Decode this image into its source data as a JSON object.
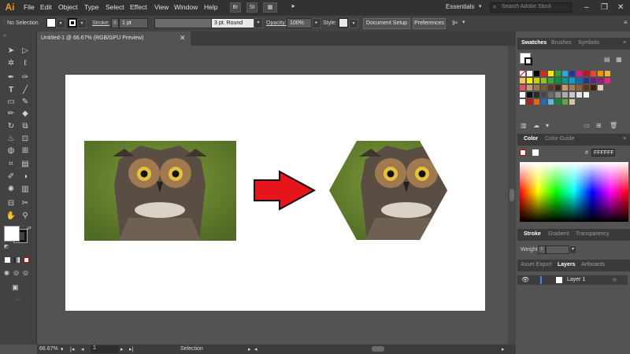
{
  "app": {
    "logo": "Ai"
  },
  "menu": [
    "File",
    "Edit",
    "Object",
    "Type",
    "Select",
    "Effect",
    "View",
    "Window",
    "Help"
  ],
  "menubar_icons": [
    "Br",
    "St"
  ],
  "workspace": "Essentials",
  "search": {
    "placeholder": "Search Adobe Stock"
  },
  "window_controls": {
    "minimize": "–",
    "restore": "❐",
    "close": "✕"
  },
  "controlbar": {
    "selection_label": "No Selection",
    "stroke_label": "Stroke:",
    "stroke_value": "1 pt",
    "brush_value": "3 pt. Round",
    "opacity_label": "Opacity:",
    "opacity_value": "100%",
    "style_label": "Style:",
    "document_setup": "Document Setup",
    "preferences": "Preferences"
  },
  "document": {
    "tab_label": "Untitled-1 @ 66.67% (RGB/GPU Preview)",
    "close": "✕"
  },
  "statusbar": {
    "zoom": "66.67%",
    "artboard": "1",
    "tool": "Selection"
  },
  "panels": {
    "swatches": {
      "tabs": [
        "Swatches",
        "Brushes",
        "Symbols"
      ]
    },
    "color": {
      "tabs": [
        "Color",
        "Color Guide"
      ],
      "hex": "FFFFFF"
    },
    "stroke": {
      "tabs": [
        "Stroke",
        "Gradient",
        "Transparency"
      ],
      "weight_label": "Weight:"
    },
    "layers": {
      "tabs": [
        "Asset Export",
        "Layers",
        "Artboards"
      ],
      "layer_name": "Layer 1"
    }
  },
  "colors": {
    "accent_arrow": "#e8141b",
    "menubar": "#323232",
    "panel": "#535353"
  },
  "icons": [
    "selection-tool-icon",
    "direct-selection-icon",
    "magic-wand-icon",
    "lasso-icon",
    "pen-icon",
    "curvature-icon",
    "type-icon",
    "line-icon",
    "rectangle-icon",
    "paintbrush-icon",
    "pencil-icon",
    "eraser-icon",
    "rotate-icon",
    "scale-icon",
    "warp-icon",
    "free-transform-icon",
    "shape-builder-icon",
    "perspective-icon",
    "mesh-icon",
    "gradient-icon",
    "eyedropper-icon",
    "blend-icon",
    "symbol-sprayer-icon",
    "graph-icon",
    "artboard-icon",
    "slice-icon",
    "hand-icon",
    "zoom-icon",
    "eye-icon"
  ]
}
